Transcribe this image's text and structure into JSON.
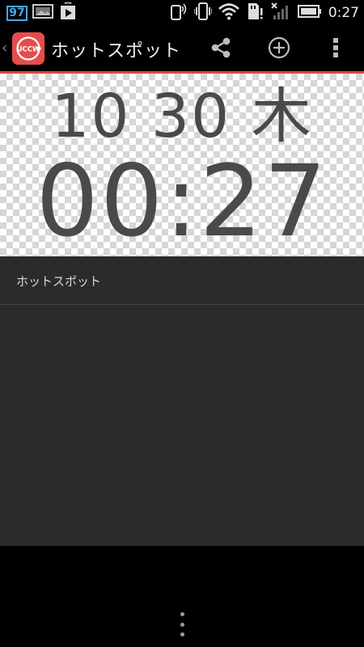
{
  "status_bar": {
    "badge_number": "97",
    "clock": "0:27",
    "icons": [
      "gallery-icon",
      "play-store-icon",
      "phone-signal-icon",
      "vibrate-icon",
      "wifi-icon",
      "sd-card-alert-icon",
      "no-signal-icon",
      "battery-icon"
    ]
  },
  "action_bar": {
    "back_glyph": "‹",
    "app_icon_text": "UCCW",
    "title": "ホットスポット",
    "actions": [
      "share-icon",
      "add-icon",
      "overflow-menu-icon"
    ]
  },
  "colors": {
    "accent_line": "#e0453e",
    "app_icon_bg": "#e74c4c",
    "content_bg": "#2b2b2b",
    "clock_text": "#4a4a4a"
  },
  "widget_preview": {
    "date_text": "10 30 木",
    "time_text": "00:27"
  },
  "list": {
    "items": [
      {
        "label": "ホットスポット"
      }
    ]
  }
}
